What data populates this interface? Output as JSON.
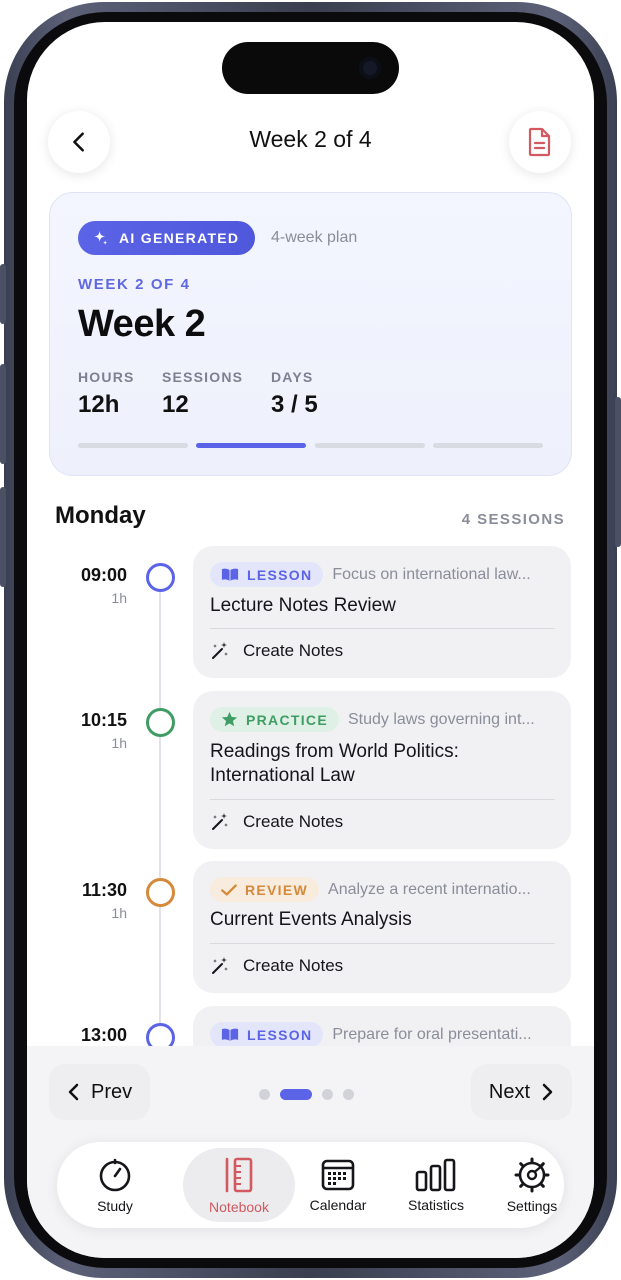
{
  "header": {
    "title": "Week 2 of 4",
    "back_icon": "chevron-left-icon",
    "doc_icon": "document-icon"
  },
  "summary": {
    "badge": "AI GENERATED",
    "badge_icon": "sparkle-icon",
    "plan_label": "4-week plan",
    "overline": "WEEK 2 OF 4",
    "title": "Week 2",
    "stats": [
      {
        "label": "HOURS",
        "value": "12h"
      },
      {
        "label": "SESSIONS",
        "value": "12"
      },
      {
        "label": "DAYS",
        "value": "3 / 5"
      }
    ],
    "progress": {
      "total_weeks": 4,
      "current_week": 2
    }
  },
  "day": {
    "title": "Monday",
    "count": "4 SESSIONS"
  },
  "sessions": [
    {
      "time": "09:00",
      "duration": "1h",
      "tag": "LESSON",
      "tag_icon": "book-icon",
      "description": "Focus on international law...",
      "title": "Lecture Notes Review",
      "action": "Create Notes",
      "action_icon": "magic-wand-icon",
      "color": "#5b63e6"
    },
    {
      "time": "10:15",
      "duration": "1h",
      "tag": "PRACTICE",
      "tag_icon": "star-icon",
      "description": "Study laws governing int...",
      "title": "Readings from World Politics: International Law",
      "action": "Create Notes",
      "action_icon": "magic-wand-icon",
      "color": "#3f9d64"
    },
    {
      "time": "11:30",
      "duration": "1h",
      "tag": "REVIEW",
      "tag_icon": "checkmark-icon",
      "description": "Analyze a recent internatio...",
      "title": "Current Events Analysis",
      "action": "Create Notes",
      "action_icon": "magic-wand-icon",
      "color": "#d5893a"
    },
    {
      "time": "13:00",
      "duration": "",
      "tag": "LESSON",
      "tag_icon": "book-icon",
      "description": "Prepare for oral presentati...",
      "title": "",
      "action": "",
      "action_icon": "magic-wand-icon",
      "color": "#5b63e6"
    }
  ],
  "pager": {
    "prev": "Prev",
    "next": "Next",
    "pages": 4,
    "current": 2
  },
  "tabbar": {
    "items": [
      {
        "label": "Study",
        "icon": "timer-icon"
      },
      {
        "label": "Notebook",
        "icon": "notebook-icon",
        "active": true
      },
      {
        "label": "Calendar",
        "icon": "calendar-icon"
      },
      {
        "label": "Statistics",
        "icon": "bar-chart-icon"
      },
      {
        "label": "Settings",
        "icon": "gear-icon"
      }
    ]
  },
  "colors": {
    "accent": "#5b63e6",
    "practice": "#3f9d64",
    "review": "#d5893a",
    "notebook_active": "#d2595f"
  }
}
